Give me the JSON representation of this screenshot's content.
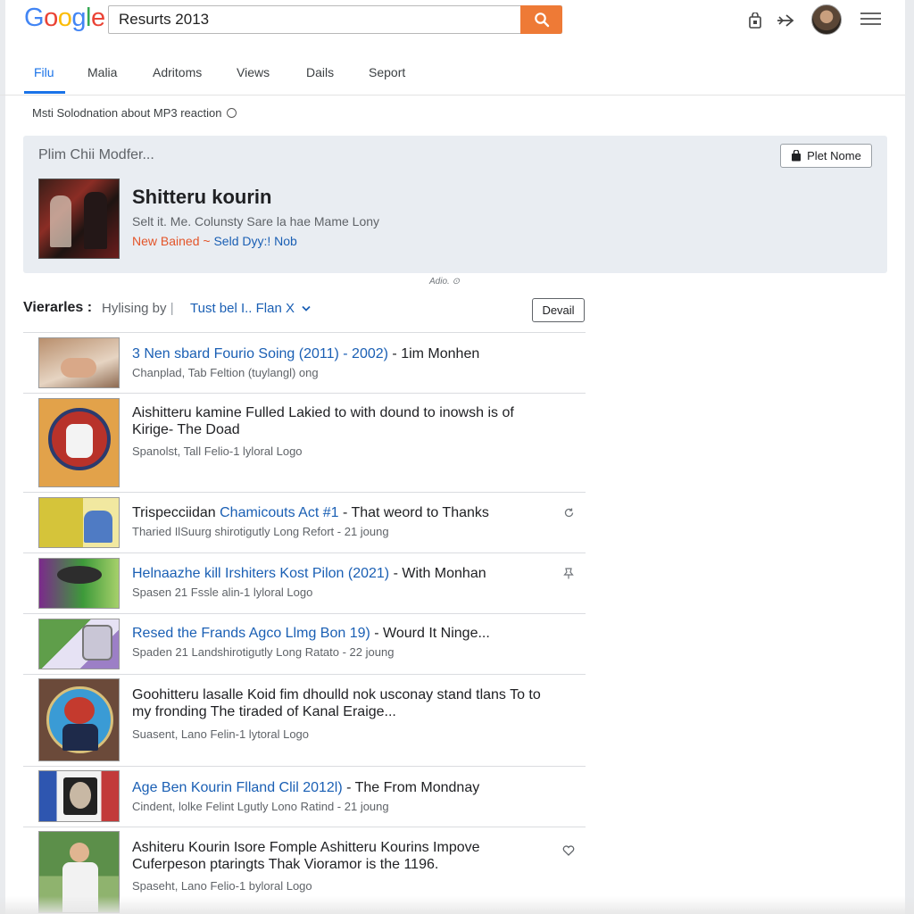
{
  "header": {
    "logo_letters": [
      "G",
      "o",
      "o",
      "g",
      "l",
      "e"
    ],
    "logo_colors": [
      "#4285f4",
      "#ea4335",
      "#fbbc05",
      "#4285f4",
      "#34a853",
      "#ea4335"
    ],
    "search_value": "Resurts 2013",
    "search_button_color": "#ee7a36",
    "icons": [
      "bag-icon",
      "share-arrow-icon",
      "avatar",
      "hamburger-menu-icon"
    ]
  },
  "tabs": [
    {
      "label": "Filu",
      "active": true
    },
    {
      "label": "Malia"
    },
    {
      "label": "Adritoms"
    },
    {
      "label": "Views"
    },
    {
      "label": "Dails"
    },
    {
      "label": "Seport"
    }
  ],
  "info_line": "Msti Solodnation about MP3 reaction",
  "featured": {
    "heading": "Plim Chii Modfer...",
    "button_label": "Plet Nome",
    "title": "Shitteru kourin",
    "subtitle": "Selt it. Me. Colunsty Sare la hae Mame Lony",
    "link_red": "New Bained ~",
    "link_blue": "Seld Dyy:! Nob"
  },
  "audio_label": "Adio. ⊙",
  "filter": {
    "label": "Vierarles",
    "sep": ":",
    "by_text": "Hylising by",
    "bar": "|",
    "link": "Tust bel I.. Flan X",
    "detail_button": "Devail"
  },
  "results": [
    {
      "plain_pre": "",
      "link": "3 Nen sbard Fourio Soing (2011) - 2002)",
      "plain_post": " - 1im Monhen",
      "sub": "Chanplad, Tab Feltion (tuylangl) ong",
      "icon": ""
    },
    {
      "plain_pre": "Aishitteru kamine Fulled Lakied to with dound to inowsh is of Kirige- The Doad",
      "link": "",
      "plain_post": "",
      "sub": "Spanolst, Tall Felio-1 lyloral Logo",
      "icon": ""
    },
    {
      "plain_pre": "Trispecciidan ",
      "link": "Chamicouts Act #1",
      "plain_post": " - That weord to Thanks",
      "sub": "Tharied IlSuurg shirotigutly Long Refort - 21 joung",
      "icon": "refresh-icon"
    },
    {
      "plain_pre": "",
      "link": "Helnaazhe kill Irshiters Kost Pilon (2021)",
      "plain_post": " - With Monhan",
      "sub": "Spasen 21 Fssle alin-1 lyloral Logo",
      "icon": "pin-icon"
    },
    {
      "plain_pre": "",
      "link": "Resed the Frands Agco Llmg Bon 19)",
      "plain_post": " - Wourd It Ninge...",
      "sub": "Spaden 21 Landshirotigutly Long Ratato - 22 joung",
      "icon": ""
    },
    {
      "plain_pre": "Goohitteru lasalle Koid fim dhoulld nok usconay stand tlans To to my fronding The tiraded of Kanal Eraige...",
      "link": "",
      "plain_post": "",
      "sub": "Suasent, Lano Felin-1 lytoral Logo",
      "icon": ""
    },
    {
      "plain_pre": "",
      "link": "Age Ben Kourin Flland Clil 2012l)",
      "plain_post": " - The From Mondnay",
      "sub": "Cindent, lolke Felint Lgutly Lono Ratind - 21 joung",
      "icon": ""
    },
    {
      "plain_pre": "Ashiteru Kourin Isore Fomple Ashitteru Kourins Impove Cuferpeson ptaringts Thak Vioramor is the 1196.",
      "link": "",
      "plain_post": "",
      "sub": "Spaseht, Lano Felio-1 byloral Logo",
      "icon": "heart-icon"
    }
  ]
}
